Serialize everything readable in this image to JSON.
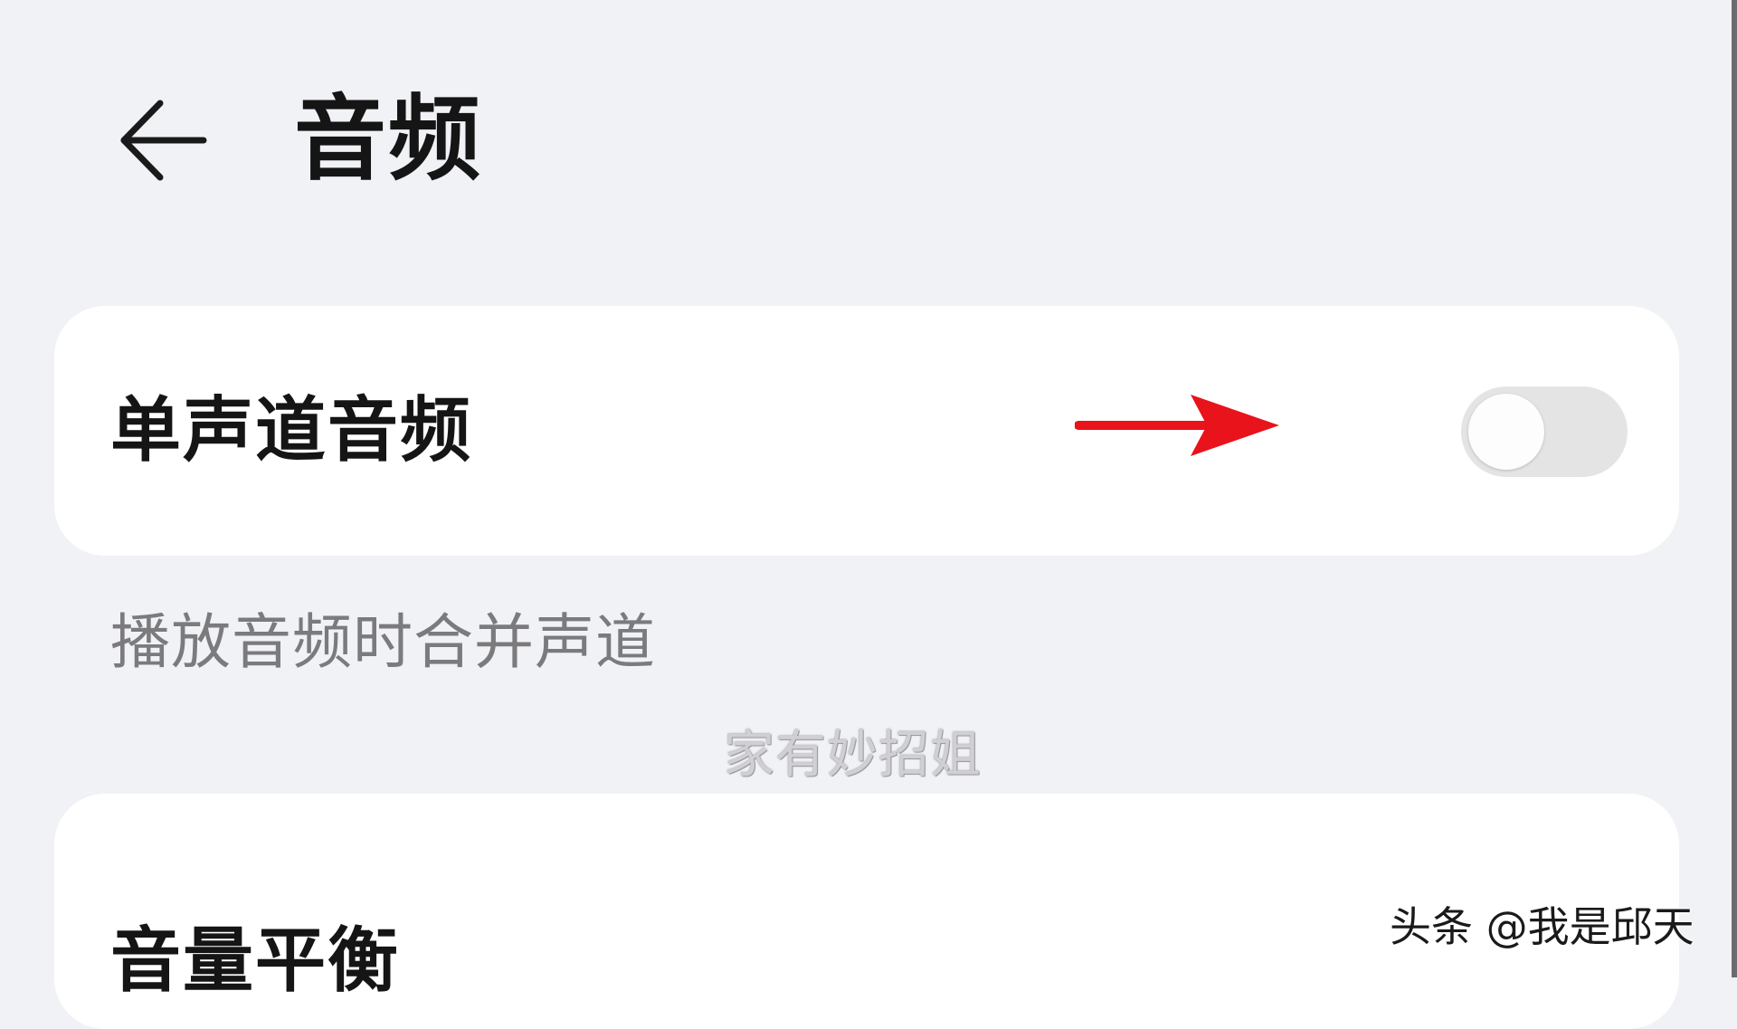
{
  "header": {
    "title": "音频",
    "back_icon": "arrow-left-icon"
  },
  "settings": [
    {
      "label": "单声道音频",
      "toggle": {
        "state": "off"
      },
      "description": "播放音频时合并声道"
    },
    {
      "label": "音量平衡"
    }
  ],
  "annotation": {
    "icon": "arrow-right-icon",
    "color": "#e8131b"
  },
  "watermarks": {
    "center": "家有妙招姐",
    "corner": "头条 @我是邱天"
  },
  "colors": {
    "background": "#f1f2f6",
    "card": "#ffffff",
    "toggle_off": "#e4e4e4",
    "annotation_red": "#e8131b"
  }
}
